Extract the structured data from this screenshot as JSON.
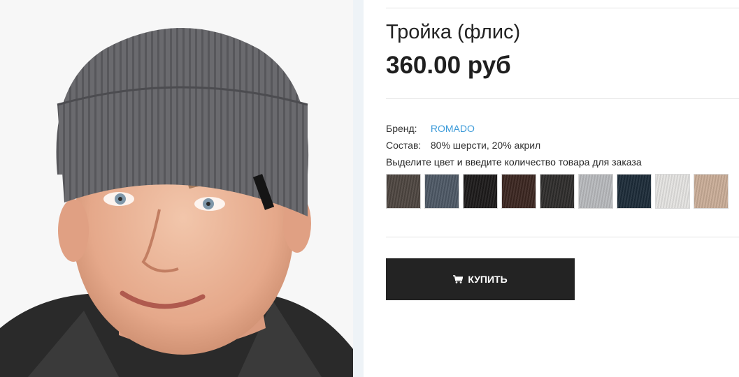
{
  "product": {
    "title": "Тройка (флис)",
    "price": "360.00 руб",
    "photo_icon": "product-photo-man-in-knit-hat"
  },
  "attributes": {
    "brand_label": "Бренд:",
    "brand_value": "ROMADO",
    "composition_label": "Состав:",
    "composition_value": "80% шерсти, 20% акрил"
  },
  "color_hint": "Выделите цвет и введите количество товара для заказа",
  "colors": [
    {
      "name": "swatch-brown-gray",
      "hex": "#4d4540"
    },
    {
      "name": "swatch-slate-blue",
      "hex": "#4d5865"
    },
    {
      "name": "swatch-black",
      "hex": "#1c1a1a"
    },
    {
      "name": "swatch-dark-brown",
      "hex": "#3b2620"
    },
    {
      "name": "swatch-charcoal",
      "hex": "#2e2c2b"
    },
    {
      "name": "swatch-light-gray",
      "hex": "#b7b9bc"
    },
    {
      "name": "swatch-navy",
      "hex": "#1c2b38"
    },
    {
      "name": "swatch-white",
      "hex": "#e4e3e1"
    },
    {
      "name": "swatch-beige",
      "hex": "#c9ac97"
    }
  ],
  "buy_button": {
    "label": "КУПИТЬ",
    "icon": "cart-icon"
  },
  "theme": {
    "link_color": "#3c9bd9",
    "button_color": "#232323"
  }
}
